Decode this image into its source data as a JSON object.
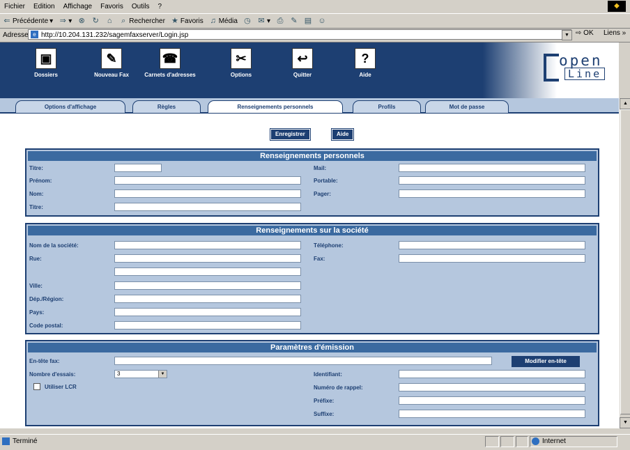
{
  "menu": [
    "Fichier",
    "Edition",
    "Affichage",
    "Favoris",
    "Outils",
    "?"
  ],
  "toolbar": {
    "back": "Précédente",
    "search": "Rechercher",
    "favorites": "Favoris",
    "media": "Média"
  },
  "address": {
    "label": "Adresse",
    "url": "http://10.204.131.232/sagemfaxserver/Login.jsp",
    "go": "OK",
    "links": "Liens"
  },
  "nav": [
    "Dossiers",
    "Nouveau Fax",
    "Carnets d'adresses",
    "Options",
    "Quitter",
    "Aide"
  ],
  "logo": {
    "top": "open",
    "bottom": "Line"
  },
  "tabs": [
    "Options d'affichage",
    "Règles",
    "Renseignements personnels",
    "Profils",
    "Mot de passe"
  ],
  "actions": {
    "save": "Enregistrer",
    "help": "Aide"
  },
  "personal": {
    "title": "Renseignements personnels",
    "labels": {
      "titre1": "Titre:",
      "prenom": "Prénom:",
      "nom": "Nom:",
      "titre2": "Titre:",
      "mail": "Mail:",
      "portable": "Portable:",
      "pager": "Pager:"
    }
  },
  "company": {
    "title": "Renseignements sur la société",
    "labels": {
      "societe": "Nom de la société:",
      "rue": "Rue:",
      "ville": "Ville:",
      "region": "Dép./Région:",
      "pays": "Pays:",
      "cp": "Code postal:",
      "tel": "Téléphone:",
      "fax": "Fax:"
    }
  },
  "sending": {
    "title": "Paramètres d'émission",
    "labels": {
      "entete": "En-tête fax:",
      "essais": "Nombre d'essais:",
      "lcr": "Utiliser LCR",
      "ident": "Identifiant:",
      "rappel": "Numéro de rappel:",
      "prefixe": "Préfixe:",
      "suffixe": "Suffixe:"
    },
    "modify_button": "Modifier en-tête",
    "essais_value": "3"
  },
  "status": {
    "text": "Terminé",
    "zone": "Internet"
  }
}
